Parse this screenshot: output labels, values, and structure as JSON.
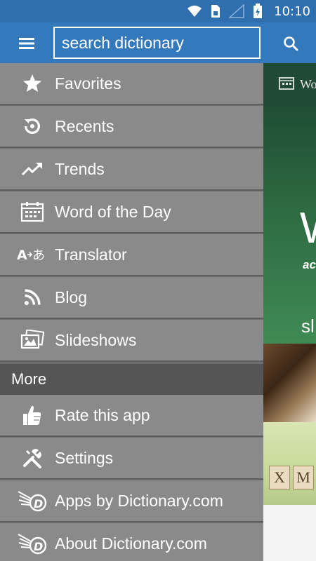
{
  "status_bar": {
    "time": "10:10",
    "icons": [
      "wifi-icon",
      "sim-icon",
      "signal-icon",
      "battery-icon"
    ]
  },
  "app_bar": {
    "menu_icon": "hamburger-menu-icon",
    "search_placeholder": "search dictionary",
    "search_icon": "search-icon"
  },
  "drawer": {
    "items": [
      {
        "label": "Favorites",
        "icon": "star-icon"
      },
      {
        "label": "Recents",
        "icon": "history-icon"
      },
      {
        "label": "Trends",
        "icon": "trending-up-icon"
      },
      {
        "label": "Word of the Day",
        "icon": "calendar-icon"
      },
      {
        "label": "Translator",
        "icon": "translate-icon"
      },
      {
        "label": "Blog",
        "icon": "rss-icon"
      },
      {
        "label": "Slideshows",
        "icon": "photos-icon"
      }
    ],
    "more_header": "More",
    "more_items": [
      {
        "label": "Rate this app",
        "icon": "thumbs-up-icon"
      },
      {
        "label": "Settings",
        "icon": "tools-icon"
      },
      {
        "label": "Apps by Dictionary.com",
        "icon": "dictionary-logo-icon"
      },
      {
        "label": "About Dictionary.com",
        "icon": "dictionary-logo-icon"
      }
    ]
  },
  "background_content": {
    "wotd_label": "Wo",
    "big_letter": "W",
    "small_text": "ac",
    "sl_text": "sl",
    "tiles": [
      "X",
      "M"
    ]
  },
  "colors": {
    "status_bar": "#2f6fb0",
    "app_bar": "#3579bd",
    "drawer_item": "#8a8a8a",
    "section_header": "#555555"
  }
}
